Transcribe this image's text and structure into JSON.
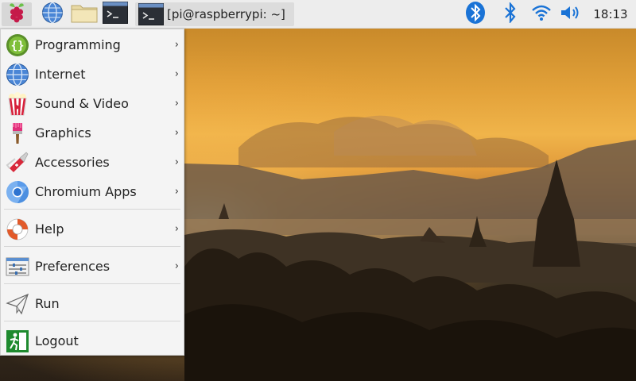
{
  "panel": {
    "task_label": "[pi@raspberrypi: ~]",
    "clock": "18:13",
    "launchers": [
      "raspberry-icon",
      "globe-icon",
      "folder-icon",
      "terminal-icon"
    ],
    "tray": [
      "bluetooth-icon",
      "bluetooth-icon",
      "wifi-icon",
      "volume-icon"
    ]
  },
  "menu": {
    "items": [
      {
        "label": "Programming",
        "icon": "code-braces-icon",
        "submenu": true
      },
      {
        "label": "Internet",
        "icon": "globe-icon",
        "submenu": true
      },
      {
        "label": "Sound & Video",
        "icon": "popcorn-icon",
        "submenu": true
      },
      {
        "label": "Graphics",
        "icon": "paintbrush-icon",
        "submenu": true
      },
      {
        "label": "Accessories",
        "icon": "pocket-knife-icon",
        "submenu": true
      },
      {
        "label": "Chromium Apps",
        "icon": "chromium-icon",
        "submenu": true
      },
      {
        "label": "Help",
        "icon": "lifebuoy-icon",
        "submenu": true
      },
      {
        "label": "Preferences",
        "icon": "sliders-icon",
        "submenu": true
      },
      {
        "label": "Run",
        "icon": "paper-plane-icon",
        "submenu": false
      },
      {
        "label": "Logout",
        "icon": "exit-icon",
        "submenu": false
      }
    ],
    "arrow": "›"
  },
  "colors": {
    "panel_bg": "#ededed",
    "menu_bg": "#f4f4f4",
    "bluetooth_blue": "#1a73d6",
    "raspberry_red": "#c51a4a",
    "leaf_green": "#6cc04a"
  }
}
